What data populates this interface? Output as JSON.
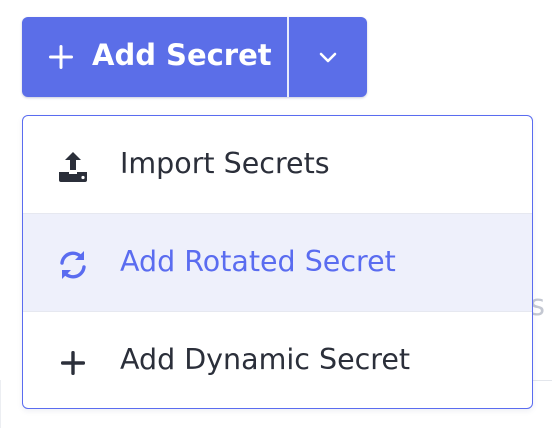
{
  "background": {
    "fragment_text": "ts"
  },
  "split_button": {
    "main_label": "Add Secret",
    "main_icon": "plus-icon",
    "toggle_icon": "chevron-down-icon",
    "color": "#5b6ee8"
  },
  "menu": {
    "border_color": "#5a6cf0",
    "items": [
      {
        "label": "Import Secrets",
        "icon": "upload-tray-icon",
        "state": "normal"
      },
      {
        "label": "Add Rotated Secret",
        "icon": "rotate-icon",
        "state": "hovered"
      },
      {
        "label": "Add Dynamic Secret",
        "icon": "plus-icon",
        "state": "normal"
      }
    ],
    "highlight_color": "#eef0fb",
    "accent_text_color": "#5a6cf0"
  }
}
